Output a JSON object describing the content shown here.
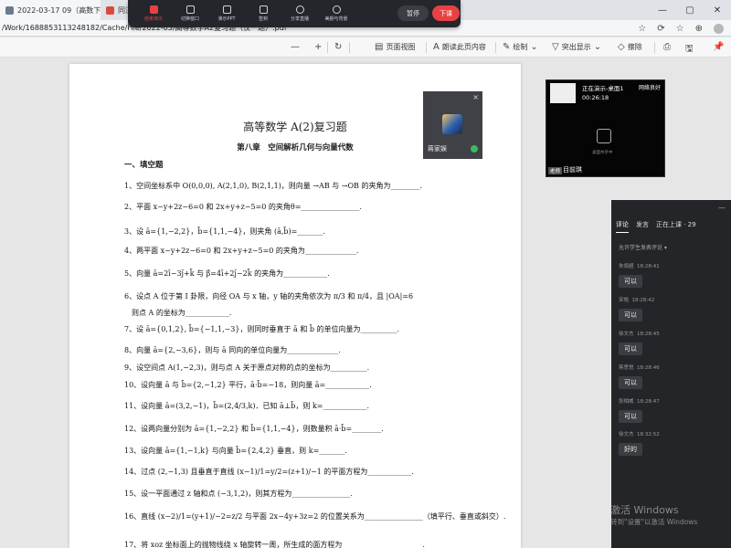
{
  "browser": {
    "tabs": [
      {
        "label": "2022-03-17 09（高数下相关）",
        "close": "×"
      },
      {
        "label": "同济·",
        "close": ""
      }
    ],
    "url": "/Work/1688853113248182/Cache/File/2022-03/高等数学A2复习题（仅一题）.pdf",
    "window_controls": [
      "—",
      "▢",
      "✕"
    ],
    "addr_icons": [
      "☆",
      "⟳",
      "☆",
      "⊕"
    ]
  },
  "classroom_toolbar": {
    "items": [
      {
        "label": "结束演示",
        "icon": "stop-icon"
      },
      {
        "label": "切换窗口",
        "icon": "window-icon"
      },
      {
        "label": "演示PPT",
        "icon": "ppt-icon"
      },
      {
        "label": "签到",
        "icon": "checkin-icon"
      },
      {
        "label": "分享直播",
        "icon": "share-icon"
      },
      {
        "label": "美颜与背景",
        "icon": "sparkle-icon"
      }
    ],
    "pause_label": "暂停",
    "end_label": "下课",
    "accent": "#e84141"
  },
  "pdf_toolbar": {
    "zoom_out": "—",
    "zoom_in": "+",
    "rotate": "↻",
    "page_view": "页面视图",
    "read_aloud": "朗读此页内容",
    "draw": "绘制",
    "highlight": "突出显示",
    "erase": "擦除",
    "print": "⎙",
    "save": "🖫",
    "pin": "📌"
  },
  "document": {
    "title": "高等数学 A(2)复习题",
    "chapter": "第八章　空间解析几何与向量代数",
    "section": "一、填空题",
    "questions": [
      "1、空间坐标系中 O(0,0,0), A(2,1,0), B(2,1,1)，则向量 →AB 与 →OB 的夹角为________.",
      "2、平面 x−y+2z−6=0 和 2x+y+z−5=0 的夹角θ=________________.",
      "3、设 ā={1,−2,2}，b̄={1,1,−4}，则夹角 (ā,b̄)=_______.",
      "4、两平面 x−y+2z−6=0 和 2x+y+z−5=0 的夹角为______________.",
      "5、向量 ā=2ī−3j̄+k̄ 与 β̄=4ī+2j̄−2k̄ 的夹角为____________.",
      "6、设点 A 位于第 I 卦限，向径 OA 与 x 轴，y 轴的夹角依次为 π/3 和 π/4，且 |OA|=6",
      "则点 A 的坐标为____________.",
      "7、设 ā={0,1,2}, b̄={−1,1,−3}，则同时垂直于 ā 和 b̄ 的单位向量为__________.",
      "8、向量 ā={2,−3,6}，则与 ā 同向的单位向量为______________.",
      "9、设空间点 A(1,−2,3)，则与点 A 关于原点对称的点的坐标为__________.",
      "10、设向量 ā 与 b̄={2,−1,2} 平行，ā·b̄=−18，则向量 ā=____________.",
      "11、设向量 ā=(3,2,−1)，b̄=(2,4/3,k)．已知 ā⊥b̄，则 k=____________.",
      "12、设两向量分别为 ā={1,−2,2} 和 b̄={1,1,−4}，则数量积 ā·b̄=________.",
      "13、设向量 ā={1,−1,k} 与向量 b̄={2,4,2} 垂直，则 k=_______.",
      "14、过点 (2,−1,3) 且垂直于直线 (x−1)/1=y/2=(z+1)/−1 的平面方程为____________.",
      "15、设一平面通过 z 轴和点 (−3,1,2)，则其方程为________________.",
      "16、直线 (x−2)/1=(y+1)/−2=z/2 与平面 2x−4y+3z=2 的位置关系为________________（填平行、垂直或斜交）.",
      "17、将 xoz 坐标面上的抛物线绕 x 轴旋转一周，所生成的面方程为______________________."
    ]
  },
  "presenter_tile": {
    "name": "蒋家娱",
    "close": "×"
  },
  "preview": {
    "status": "正在演示-桌面1",
    "time": "00:26:18",
    "network": "网络良好",
    "hint": "桌面共享中",
    "badge": "老师",
    "owner": "目前琪"
  },
  "chat": {
    "tabs": [
      "评论",
      "发言",
      "正在上课 · 29"
    ],
    "collapse": "—",
    "subtitle": "允许学生发表评论 ▾",
    "messages": [
      {
        "user": "朱焜超",
        "time": "18:28:41",
        "text": "可以"
      },
      {
        "user": "宋皓",
        "time": "18:28:42",
        "text": "可以"
      },
      {
        "user": "徐文杰",
        "time": "18:28:45",
        "text": "可以"
      },
      {
        "user": "蒋思悦",
        "time": "18:28:46",
        "text": "可以"
      },
      {
        "user": "张相威",
        "time": "18:28:47",
        "text": "可以"
      },
      {
        "user": "徐文杰",
        "time": "18:32:52",
        "text": "好的"
      }
    ]
  },
  "watermark": {
    "line1": "激活 Windows",
    "line2": "转到\"设置\"以激活 Windows"
  }
}
